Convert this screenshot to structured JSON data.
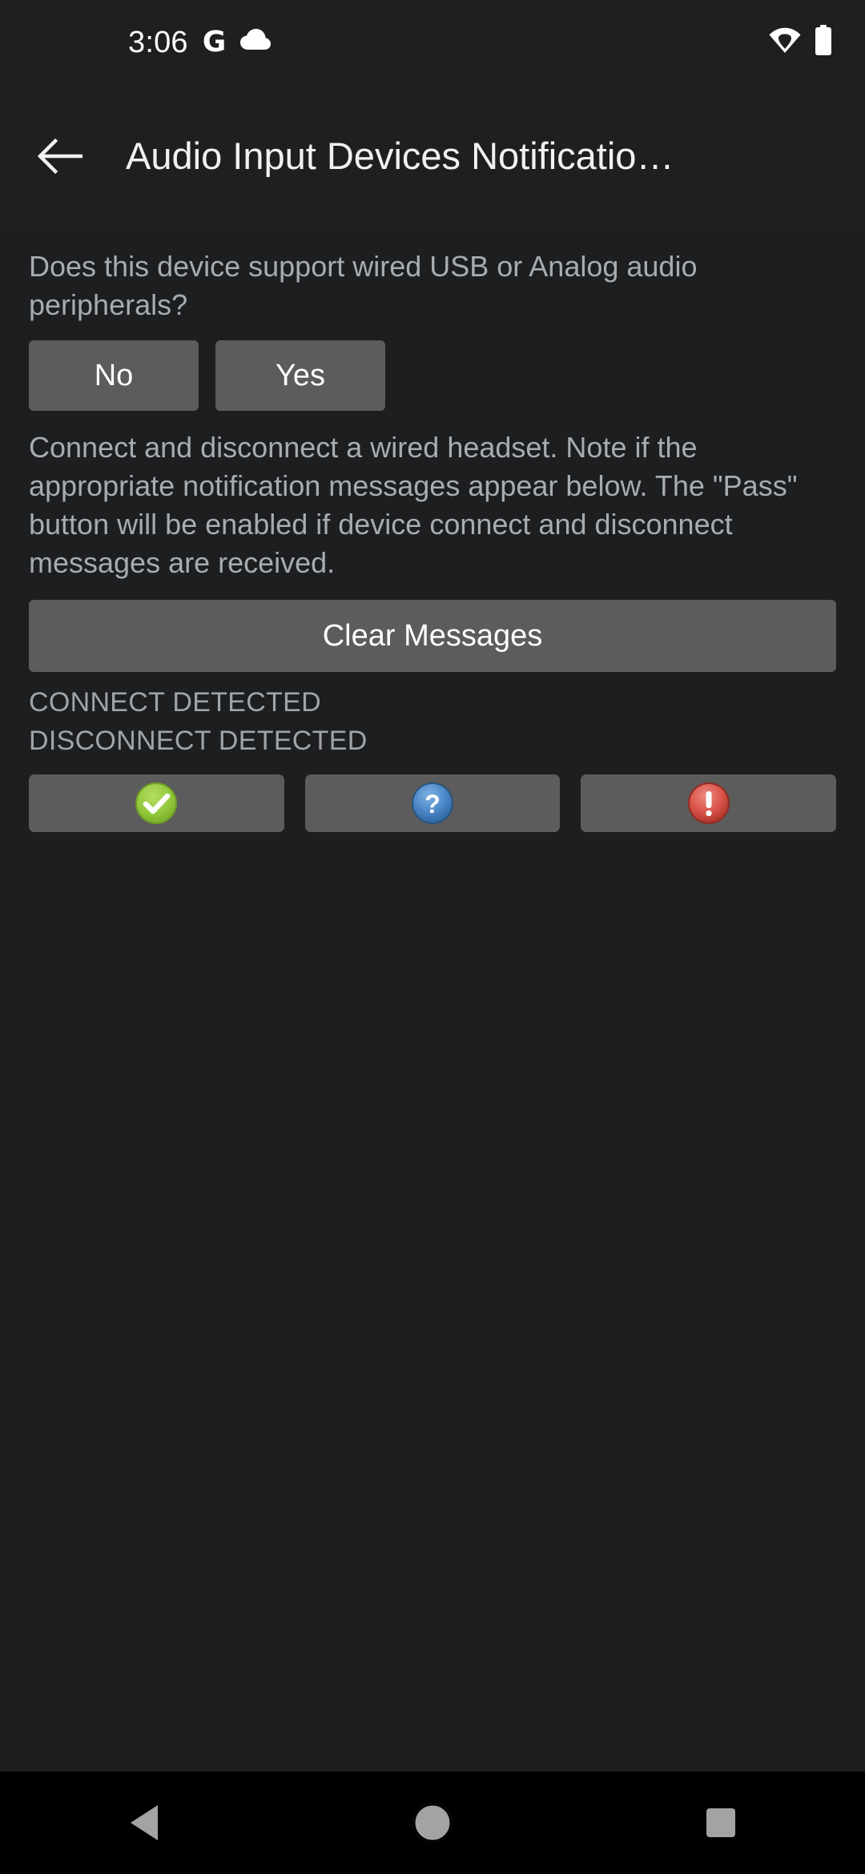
{
  "status_bar": {
    "clock": "3:06",
    "icons": [
      "google-g-icon",
      "cloud-icon",
      "wifi-icon",
      "battery-icon"
    ],
    "google_glyph": "G"
  },
  "app_bar": {
    "back_icon": "back-arrow-icon",
    "title": "Audio Input Devices Notificatio…"
  },
  "main": {
    "question": "Does this device support wired USB or Analog audio peripherals?",
    "answer_buttons": [
      {
        "label": "No",
        "name": "no-button"
      },
      {
        "label": "Yes",
        "name": "yes-button"
      }
    ],
    "instructions": "Connect and disconnect a wired headset. Note if the appropriate notification messages appear below. The \"Pass\" button will be enabled if device connect and disconnect messages are received.",
    "clear_button_label": "Clear Messages",
    "status_lines": [
      "CONNECT DETECTED",
      "DISCONNECT DETECTED"
    ],
    "result_buttons": [
      {
        "name": "pass-button",
        "icon": "check-circle-icon",
        "color": "#8cc63e"
      },
      {
        "name": "info-button",
        "icon": "question-circle-icon",
        "color": "#4a86c8"
      },
      {
        "name": "fail-button",
        "icon": "exclamation-circle-icon",
        "color": "#d9544a"
      }
    ]
  },
  "nav_bar": {
    "back": "nav-back-icon",
    "home": "nav-home-icon",
    "recents": "nav-recents-icon"
  },
  "colors": {
    "window_bg": "#1c1e20",
    "app_bar_bg": "#1d1f21",
    "button_bg": "#5c5c5c",
    "secondary_text": "#a8acb0",
    "primary_text": "#f1f1f1",
    "nav_bg": "#000000",
    "nav_icon": "#a3a3a3"
  }
}
